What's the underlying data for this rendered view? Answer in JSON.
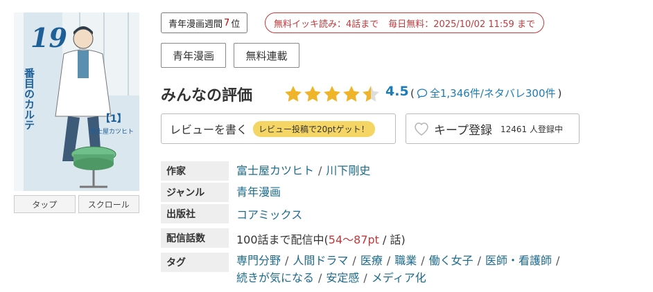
{
  "view_buttons": {
    "tap": "タップ",
    "scroll": "スクロール"
  },
  "cover": {
    "number_text": "19",
    "title_text": "番目のカルテ",
    "volume_text": "【1】",
    "author_text": "富士屋カツヒト"
  },
  "rank": {
    "prefix": "青年漫画週間",
    "number": "7",
    "suffix": "位"
  },
  "free": {
    "left": "無料イッキ読み：4話まで",
    "right": "毎日無料：2025/10/02 11:59 まで"
  },
  "genre_buttons": [
    "青年漫画",
    "無料連載"
  ],
  "rating": {
    "title": "みんなの評価",
    "score": "4.5",
    "value": 4.5,
    "max": 5,
    "open_paren": "(",
    "count_text": "全1,346件/ネタバレ300件",
    "close_paren": ")"
  },
  "review": {
    "label": "レビューを書く",
    "promo": "レビュー投稿で20ptゲット！"
  },
  "keep": {
    "label": "キープ登録",
    "count": "12461 人登録中"
  },
  "info": {
    "author_label": "作家",
    "authors": [
      "富士屋カツヒト",
      "川下剛史"
    ],
    "genre_label": "ジャンル",
    "genre": "青年漫画",
    "publisher_label": "出版社",
    "publisher": "コアミックス",
    "episodes_label": "配信話数",
    "episodes_prefix": "100話まで配信中(",
    "episodes_price": "54〜87pt",
    "episodes_suffix": " / 話)",
    "tags_label": "タグ",
    "tags": [
      "専門分野",
      "人間ドラマ",
      "医療",
      "職業",
      "働く女子",
      "医師・看護師",
      "続きが気になる",
      "安定感",
      "メディア化"
    ]
  },
  "colors": {
    "accent_blue": "#1d7bb5",
    "link": "#1c6b8e",
    "red": "#c0393b",
    "star": "#f0b429",
    "promo": "#f5d665"
  }
}
